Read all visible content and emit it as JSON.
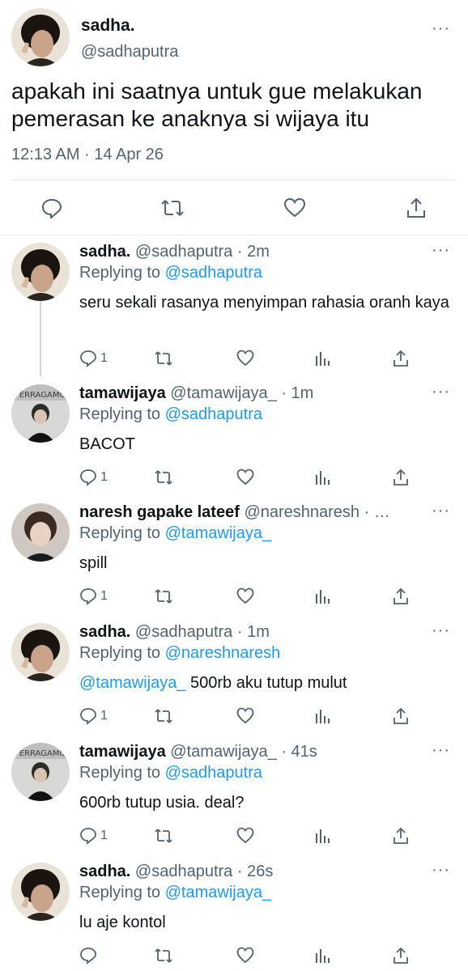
{
  "main_tweet": {
    "name": "sadha.",
    "handle": "@sadhaputra",
    "text": "apakah ini saatnya untuk gue melakukan pemerasan ke anaknya si wijaya itu",
    "timestamp": "12:13 AM · 14 Apr 26",
    "more_icon": "···"
  },
  "replies": [
    {
      "name": "sadha.",
      "meta": "@sadhaputra · 2m",
      "replying_prefix": "Replying to ",
      "replying_to": "@sadhaputra",
      "mention": "",
      "text": "seru sekali rasanya menyimpan rahasia oranh kaya",
      "reply_count": "1",
      "avatar": "curly-boy"
    },
    {
      "name": "tamawijaya",
      "meta": "@tamawijaya_ · 1m",
      "replying_prefix": "Replying to ",
      "replying_to": "@sadhaputra",
      "mention": "",
      "text": "BACOT",
      "reply_count": "1",
      "avatar": "ferragamo"
    },
    {
      "name": "naresh gapake lateef",
      "meta": "@nareshnaresh · …",
      "replying_prefix": "Replying to ",
      "replying_to": "@tamawijaya_",
      "mention": "",
      "text": "spill",
      "reply_count": "1",
      "avatar": "hair-boy"
    },
    {
      "name": "sadha.",
      "meta": "@sadhaputra · 1m",
      "replying_prefix": "Replying to ",
      "replying_to": "@nareshnaresh",
      "mention": "@tamawijaya_",
      "text": " 500rb aku tutup mulut",
      "reply_count": "1",
      "avatar": "curly-boy"
    },
    {
      "name": "tamawijaya",
      "meta": "@tamawijaya_ · 41s",
      "replying_prefix": "Replying to ",
      "replying_to": "@sadhaputra",
      "mention": "",
      "text": "600rb tutup usia. deal?",
      "reply_count": "1",
      "avatar": "ferragamo"
    },
    {
      "name": "sadha.",
      "meta": "@sadhaputra · 26s",
      "replying_prefix": "Replying to ",
      "replying_to": "@tamawijaya_",
      "mention": "",
      "text": "lu aje kontol",
      "reply_count": "",
      "avatar": "curly-boy"
    }
  ],
  "avatar_label": "FERRAGAMO",
  "colors": {
    "accent": "#1d9bf0",
    "muted": "#536471",
    "text": "#0f1419",
    "line": "#cfd9de"
  }
}
